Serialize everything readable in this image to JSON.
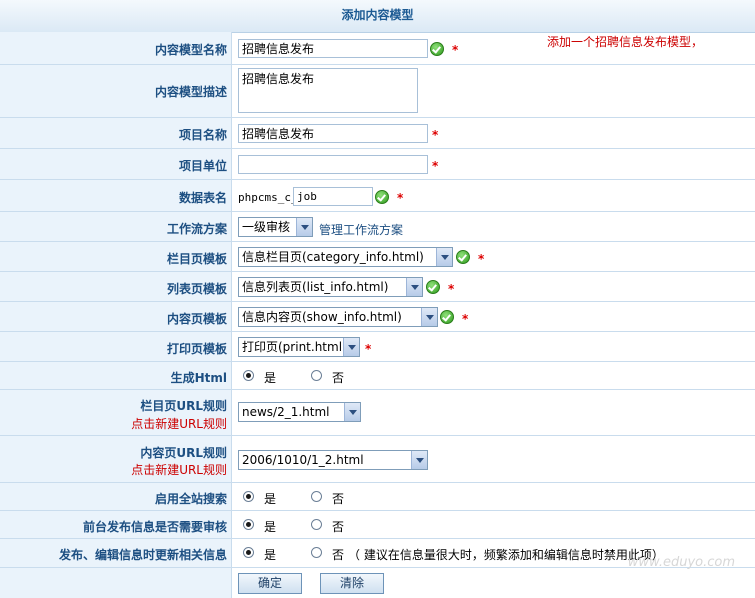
{
  "header": {
    "title": "添加内容模型"
  },
  "note": "添加一个招聘信息发布模型，",
  "fields": {
    "model_name": {
      "label": "内容模型名称",
      "value": "招聘信息发布"
    },
    "model_desc": {
      "label": "内容模型描述",
      "value": "招聘信息发布"
    },
    "item_name": {
      "label": "项目名称",
      "value": "招聘信息发布"
    },
    "item_unit": {
      "label": "项目单位",
      "value": ""
    },
    "table_name": {
      "label": "数据表名",
      "prefix": "phpcms_c_",
      "value": "job"
    },
    "workflow": {
      "label": "工作流方案",
      "selected": "一级审核",
      "link": "管理工作流方案"
    },
    "category_tpl": {
      "label": "栏目页模板",
      "selected": "信息栏目页(category_info.html)"
    },
    "list_tpl": {
      "label": "列表页模板",
      "selected": "信息列表页(list_info.html)"
    },
    "show_tpl": {
      "label": "内容页模板",
      "selected": "信息内容页(show_info.html)"
    },
    "print_tpl": {
      "label": "打印页模板",
      "selected": "打印页(print.html)"
    },
    "gen_html": {
      "label": "生成Html",
      "yes": "是",
      "no": "否",
      "value": "yes"
    },
    "cat_url": {
      "label": "栏目页URL规则",
      "sublabel": "点击新建URL规则",
      "selected": "news/2_1.html"
    },
    "show_url": {
      "label": "内容页URL规则",
      "sublabel": "点击新建URL规则",
      "selected": "2006/1010/1_2.html"
    },
    "site_search": {
      "label": "启用全站搜索",
      "yes": "是",
      "no": "否",
      "value": "yes"
    },
    "front_audit": {
      "label": "前台发布信息是否需要审核",
      "yes": "是",
      "no": "否",
      "value": "yes"
    },
    "update_related": {
      "label": "发布、编辑信息时更新相关信息",
      "yes": "是",
      "no": "否",
      "value": "yes",
      "hint": "（ 建议在信息量很大时，频繁添加和编辑信息时禁用此项）"
    }
  },
  "buttons": {
    "submit": "确定",
    "reset": "清除"
  },
  "watermark": "www.eduyo.com",
  "required_mark": "*"
}
